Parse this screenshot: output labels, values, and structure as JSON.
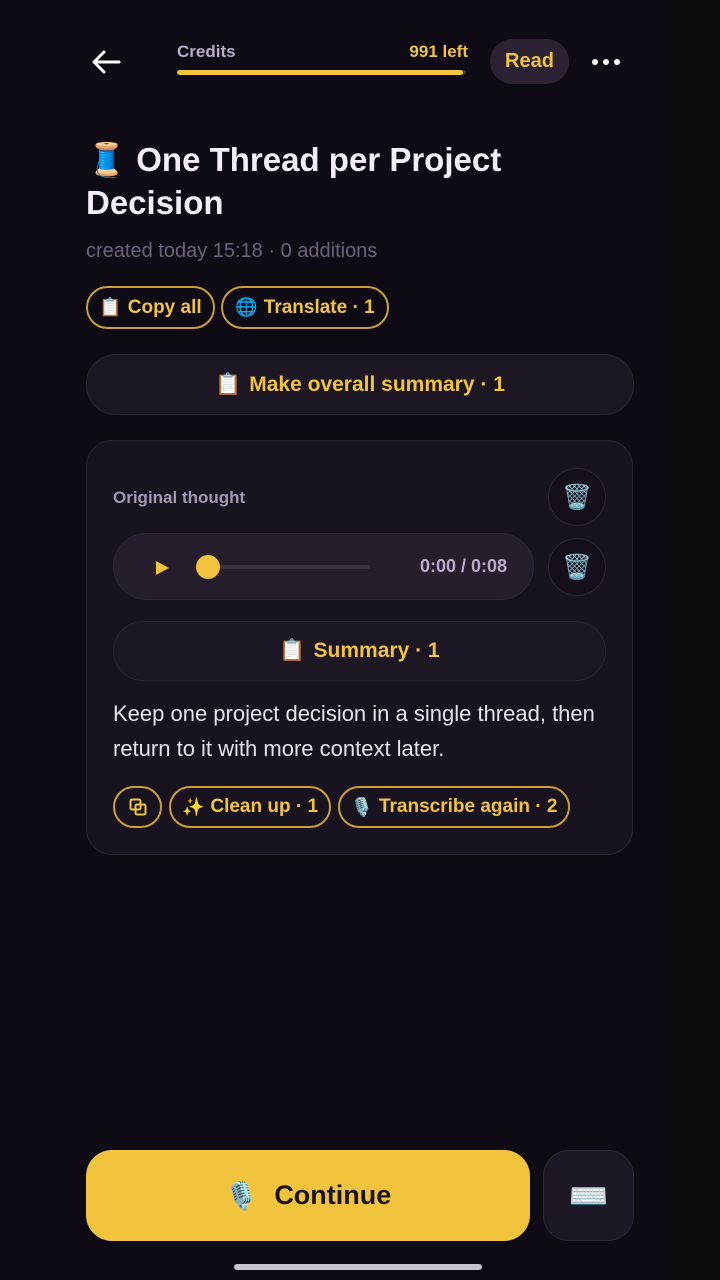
{
  "header": {
    "credits_label": "Credits",
    "credits_left": "991 left",
    "credits_fraction": 0.991,
    "read_label": "Read",
    "accent_color": "#f2c33d"
  },
  "note": {
    "title_icon": "🧵",
    "title": "One Thread per Project Decision",
    "meta": "created today 15:18 · 0 additions"
  },
  "actions": {
    "copy_all_icon": "📋",
    "copy_all": "Copy all",
    "translate_icon": "🌐",
    "translate": "Translate · 1",
    "overall_summary_icon": "📋",
    "overall_summary": "Make overall summary · 1"
  },
  "thought": {
    "label": "Original thought",
    "trash_icon": "🗑️",
    "player": {
      "time": "0:00 / 0:08",
      "progress": 0.0
    },
    "summary_icon": "📋",
    "summary": "Summary · 1",
    "text": "Keep one project decision in a single thread, then return to it with more context later.",
    "clean_up_icon": "✨",
    "clean_up": "Clean up · 1",
    "transcribe_icon": "🎙️",
    "transcribe_again": "Transcribe again · 2"
  },
  "footer": {
    "continue_icon": "🎙️",
    "continue_label": "Continue",
    "keyboard_icon": "⌨️"
  }
}
